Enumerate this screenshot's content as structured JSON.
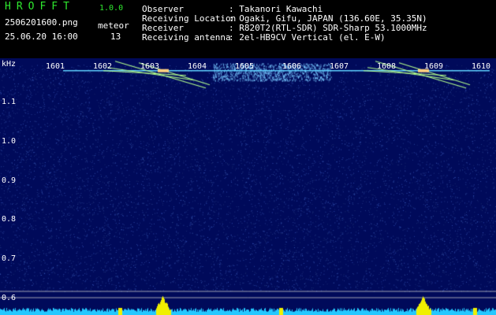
{
  "header": {
    "app_title": "HROFFT",
    "app_version": "1.0.0",
    "filename": "2506201600.png",
    "datetime": "25.06.20 16:00",
    "meteor_label": "meteor",
    "meteor_count": "13",
    "fields": [
      {
        "label": "Observer",
        "value": ": Takanori Kawachi"
      },
      {
        "label": "Receiving Location",
        "value": ": Ogaki, Gifu, JAPAN (136.60E, 35.35N)"
      },
      {
        "label": "Receiver",
        "value": ": R820T2(RTL-SDR) SDR-Sharp 53.1000MHz"
      },
      {
        "label": "Receiving antenna",
        "value": ": 2el-HB9CV Vertical (el. E-W)"
      }
    ]
  },
  "spectrogram": {
    "y_unit": "kHz",
    "y_ticks": [
      "1.1",
      "1.0",
      "0.9",
      "0.8",
      "0.7",
      "0.6"
    ],
    "x_ticks": [
      "1601",
      "1602",
      "1603",
      "1604",
      "1605",
      "1606",
      "1607",
      "1608",
      "1609",
      "1610"
    ],
    "carrier_khz": 0.98,
    "meteor_events_min": [
      1603.5,
      1609.0
    ],
    "colors": {
      "background": "#000a5a",
      "carrier": "#5fd2ff",
      "echo": "#b4ff8c",
      "level": "#24c8ff",
      "peak": "#f0f000"
    }
  }
}
